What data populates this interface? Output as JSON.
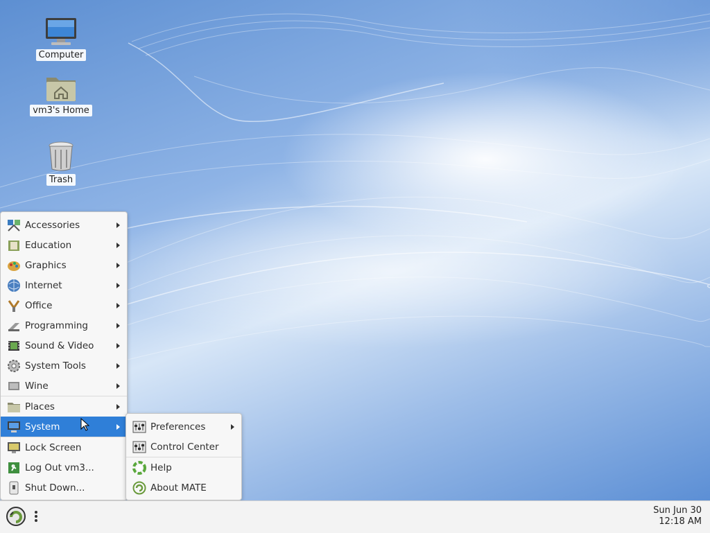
{
  "desktop": {
    "icons": [
      {
        "label": "Computer",
        "icon": "monitor-icon"
      },
      {
        "label": "vm3's Home",
        "icon": "home-folder-icon"
      },
      {
        "label": "Trash",
        "icon": "trash-icon"
      }
    ]
  },
  "main_menu": {
    "items": [
      {
        "label": "Accessories",
        "icon": "accessories-icon",
        "submenu": true
      },
      {
        "label": "Education",
        "icon": "education-icon",
        "submenu": true
      },
      {
        "label": "Graphics",
        "icon": "graphics-icon",
        "submenu": true
      },
      {
        "label": "Internet",
        "icon": "internet-icon",
        "submenu": true
      },
      {
        "label": "Office",
        "icon": "office-icon",
        "submenu": true
      },
      {
        "label": "Programming",
        "icon": "programming-icon",
        "submenu": true
      },
      {
        "label": "Sound & Video",
        "icon": "sound-video-icon",
        "submenu": true
      },
      {
        "label": "System Tools",
        "icon": "system-tools-icon",
        "submenu": true
      },
      {
        "label": "Wine",
        "icon": "wine-icon",
        "submenu": true
      },
      {
        "label": "Places",
        "icon": "places-folder-icon",
        "submenu": true
      },
      {
        "label": "System",
        "icon": "system-computer-icon",
        "submenu": true,
        "active": true
      },
      {
        "label": "Lock Screen",
        "icon": "lock-screen-icon",
        "submenu": false
      },
      {
        "label": "Log Out vm3...",
        "icon": "log-out-icon",
        "submenu": false
      },
      {
        "label": "Shut Down...",
        "icon": "shut-down-icon",
        "submenu": false
      }
    ]
  },
  "system_submenu": {
    "items": [
      {
        "label": "Preferences",
        "icon": "preferences-icon",
        "submenu": true
      },
      {
        "label": "Control Center",
        "icon": "control-center-icon",
        "submenu": false
      },
      {
        "label": "Help",
        "icon": "help-icon",
        "submenu": false
      },
      {
        "label": "About MATE",
        "icon": "mate-logo-icon",
        "submenu": false
      }
    ]
  },
  "panel": {
    "clock_date": "Sun Jun 30",
    "clock_time": "12:18 AM"
  },
  "colors": {
    "highlight": "#2f7fd8",
    "wallpaper": "#6f9edb"
  }
}
